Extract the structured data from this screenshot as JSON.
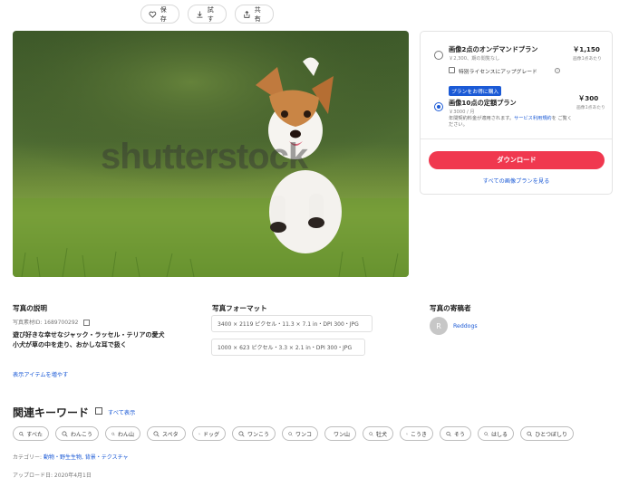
{
  "toolbar": {
    "save_label": "保存",
    "try_label": "試す",
    "share_label": "共有"
  },
  "photo": {
    "watermark": "shutterstock"
  },
  "plans": {
    "ondemand": {
      "title": "画像2点のオンデマンドプラン",
      "sub": "￥2,300、期の閲覧なし",
      "price": "￥1,150",
      "price_sub": "画像1点あたり",
      "extended_license_label": "特別ライセンスにアップグレード"
    },
    "subscription": {
      "badge": "プランをお得に購入",
      "title": "画像10点の定額プラン",
      "sub": "￥3000 / 月",
      "terms_prefix": "年間契約料金が適用されます。",
      "terms_link": "サービス利用規約",
      "terms_suffix": "を ご覧ください。",
      "price": "￥300",
      "price_sub": "画像1点あたり"
    },
    "download_label": "ダウンロード",
    "all_plans_label": "すべての画像プランを見る"
  },
  "description": {
    "heading": "写真の説明",
    "stock_id": "写真素材ID: 1689700292",
    "text_line1": "遊び好きな幸せなジャック・ラッセル・テリアの愛犬",
    "text_line2": "小犬が草の中を走り、おかしな耳で扱く",
    "more_link": "表示アイテムを増やす"
  },
  "format": {
    "heading": "写真フォーマット",
    "options": [
      "3400 × 2119 ピクセル・11.3 × 7.1 in・DPI 300・JPG",
      "1000 × 623 ピクセル・3.3 × 2.1 in・DPI 300・JPG"
    ]
  },
  "contributor": {
    "heading": "写真の寄稿者",
    "initial": "R",
    "name": "Reddogs"
  },
  "keywords": {
    "title": "関連キーワード",
    "show_all": "すべて表示",
    "chips": [
      "すべた",
      "わんこう",
      "わん山",
      "スペタ",
      "ドッグ",
      "ワンこう",
      "ワンコ",
      "ワン山",
      "牡犬",
      "こうき",
      "そう",
      "はしる",
      "ひとつぼしり"
    ]
  },
  "category": {
    "label": "カテゴリー:",
    "value": "動物・野生生物, 背景・テクスチャ"
  },
  "upload": {
    "label": "アップロード日: 2020年4月1日"
  },
  "colors": {
    "accent": "#f0384f",
    "link": "#1b5ad6"
  }
}
